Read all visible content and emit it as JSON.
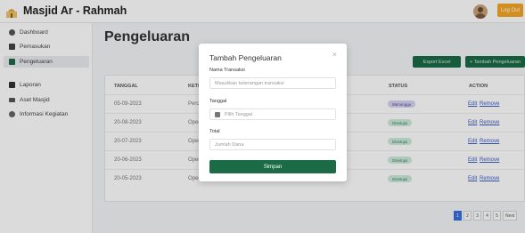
{
  "app": {
    "brand": "Masjid Ar - Rahmah",
    "logout_label": "Log Out"
  },
  "sidebar": {
    "items": [
      {
        "label": "Dashboard",
        "icon": "gear-icon"
      },
      {
        "label": "Pemasukan",
        "icon": "wallet-icon"
      },
      {
        "label": "Pengeluaran",
        "icon": "wallet-out-icon",
        "active": true
      },
      {
        "label": "Laporan",
        "icon": "report-icon"
      },
      {
        "label": "Aset Masjid",
        "icon": "asset-icon"
      },
      {
        "label": "Informasi Kegiatan",
        "icon": "info-icon"
      }
    ]
  },
  "main": {
    "title": "Pengeluaran",
    "export_label": "Export Excel",
    "add_label": "+ Tambah Pengeluaran",
    "table": {
      "headers": [
        "TANGGAL",
        "KETE",
        "STATUS",
        "ACTION"
      ],
      "rows": [
        {
          "date": "05-09-2023",
          "desc": "Perc",
          "status": "Menunggu",
          "edit": "Edit",
          "remove": "Remove"
        },
        {
          "date": "20-08-2023",
          "desc": "Oper",
          "status": "Disetujui",
          "edit": "Edit",
          "remove": "Remove"
        },
        {
          "date": "20-07-2023",
          "desc": "Oper",
          "status": "Disetujui",
          "edit": "Edit",
          "remove": "Remove"
        },
        {
          "date": "20-06-2023",
          "desc": "Oper",
          "status": "Disetujui",
          "edit": "Edit",
          "remove": "Remove"
        },
        {
          "date": "20-05-2023",
          "desc": "Oper",
          "status": "Disetujui",
          "edit": "Edit",
          "remove": "Remove"
        }
      ]
    },
    "pagination": [
      "1",
      "2",
      "3",
      "4",
      "5",
      "Next"
    ]
  },
  "modal": {
    "title": "Tambah Pengeluaran",
    "close": "×",
    "name_label": "Nama Transaksi",
    "name_placeholder": "Masukkan keterangan transaksi",
    "date_label": "Tanggal",
    "date_placeholder": "Pilih Tanggal",
    "total_label": "Total",
    "total_placeholder": "Jumlah Dana",
    "submit_label": "Simpan"
  },
  "colors": {
    "primary": "#1a6b46",
    "accent": "#f5a623",
    "link": "#3b5fc0"
  }
}
